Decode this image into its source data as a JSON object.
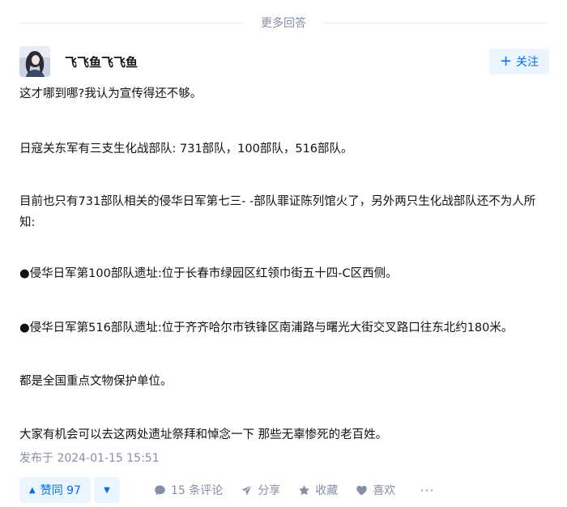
{
  "section": {
    "title": "更多回答"
  },
  "author": {
    "name": "飞飞鱼飞飞鱼",
    "follow_label": "关注",
    "follow_icon": "plus-icon"
  },
  "answer": {
    "paragraphs": [
      "这才哪到哪?我认为宣传得还不够。",
      "日寇关东军有三支生化战部队: 731部队，100部队，516部队。",
      "目前也只有731部队相关的侵华日军第七三- -部队罪证陈列馆火了，另外两只生化战部队还不为人所知:",
      "●侵华日军第100部队遗址:位于长春市绿园区红领巾街五十四-C区西侧。",
      "●侵华日军第516部队遗址:位于齐齐哈尔市铁锋区南浦路与曙光大街交叉路口往东北约180米。",
      "都是全国重点文物保护单位。",
      "大家有机会可以去这两处遗址祭拜和悼念一下 那些无辜惨死的老百姓。"
    ],
    "published": "发布于 2024-01-15 15:51"
  },
  "actions": {
    "upvote_label": "赞同 97",
    "comments_label": "15 条评论",
    "share_label": "分享",
    "favorite_label": "收藏",
    "like_label": "喜欢",
    "more_label": "···"
  },
  "colors": {
    "accent": "#056de8",
    "accent_bg": "#ebf5ff",
    "muted": "#8590a6",
    "text": "#121212"
  }
}
